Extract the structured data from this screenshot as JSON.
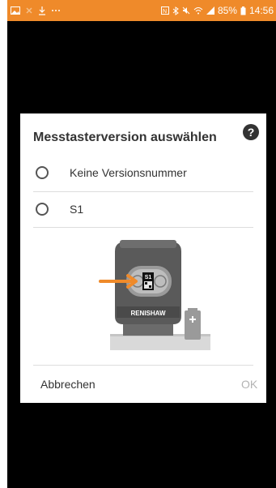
{
  "status_bar": {
    "battery": "85%",
    "time": "14:56",
    "background": "#ef8a2a"
  },
  "dialog": {
    "title": "Messtasterversion auswählen",
    "help_icon": "question-circle-icon",
    "options": [
      {
        "label": "Keine Versionsnummer",
        "selected": false
      },
      {
        "label": "S1",
        "selected": false
      }
    ],
    "illustration": {
      "brand_text": "RENISHAW",
      "tag_text": "S1"
    },
    "buttons": {
      "cancel": "Abbrechen",
      "ok": "OK"
    }
  }
}
